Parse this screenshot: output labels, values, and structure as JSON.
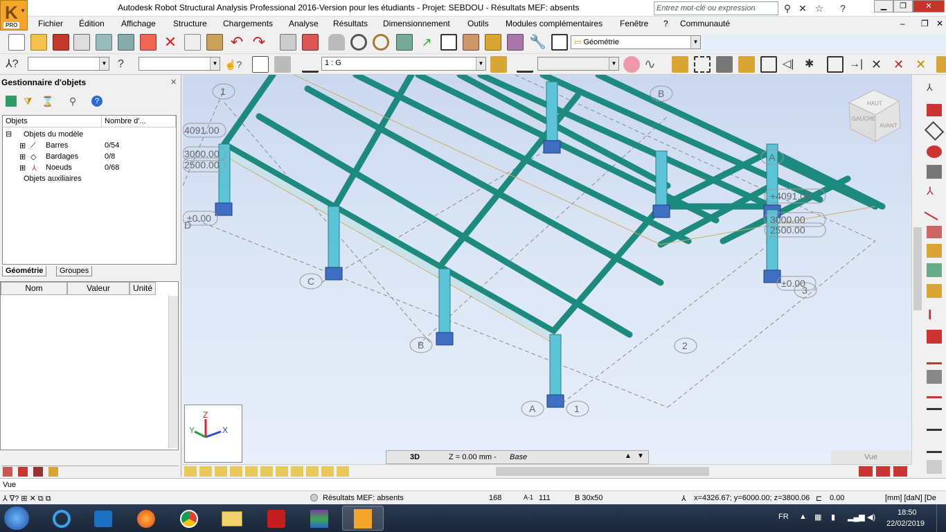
{
  "app": {
    "title": "Autodesk Robot Structural Analysis Professional 2016-Version pour les étudiants - Projet: SEBDOU - Résultats MEF: absents",
    "logo_badge": "PRO",
    "search_placeholder": "Entrez mot-clé ou expression"
  },
  "menu": [
    "Fichier",
    "Édition",
    "Affichage",
    "Structure",
    "Chargements",
    "Analyse",
    "Résultats",
    "Dimensionnement",
    "Outils",
    "Modules complémentaires",
    "Fenêtre",
    "?",
    "Communauté"
  ],
  "toolbar": {
    "layout_select": "Géométrie",
    "case_select": "1 : G"
  },
  "object_manager": {
    "title": "Gestionnaire d'objets",
    "col_objects": "Objets",
    "col_count": "Nombre d'...",
    "root": "Objets du modèle",
    "items": [
      {
        "label": "Barres",
        "count": "0/54"
      },
      {
        "label": "Bardages",
        "count": "0/8"
      },
      {
        "label": "Noeuds",
        "count": "0/68"
      }
    ],
    "aux": "Objets auxiliaires",
    "tabs": [
      "Géométrie",
      "Groupes"
    ],
    "props_cols": [
      "Nom",
      "Valeur",
      "Unité"
    ]
  },
  "viewport": {
    "view_label": "3D",
    "plane_label": "Z = 0.00 mm - ",
    "plane_name": "Base",
    "view_name": "Vue",
    "viewcube": {
      "top": "HAUT",
      "left": "GAUCHE",
      "front": "AVANT"
    },
    "axes": {
      "x": "X",
      "y": "Y",
      "z": "Z"
    },
    "grid_labels": [
      "1",
      "B",
      "A",
      "C",
      "B",
      "2",
      "A",
      "1",
      "D",
      "3"
    ],
    "level_labels": [
      "4091.00",
      "3000.00",
      "2500.00",
      "±0.00",
      "+4091.00",
      "3000.00",
      "2500.00",
      "±0.00"
    ]
  },
  "status": {
    "view_field": "Vue",
    "fem": "Résultats MEF: absents",
    "nodes": "168",
    "bars": "111",
    "section": "B 30x50",
    "coords": "x=4326.67; y=6000.00; z=3800.06",
    "angle": "0.00",
    "units": "[mm] [daN] [De"
  },
  "taskbar": {
    "lang": "FR",
    "time": "18:50",
    "date": "22/02/2019"
  },
  "colors": {
    "steel": "#1f8a80",
    "steel_dark": "#156b63",
    "column": "#56c4d6",
    "base": "#3a6fc4"
  }
}
